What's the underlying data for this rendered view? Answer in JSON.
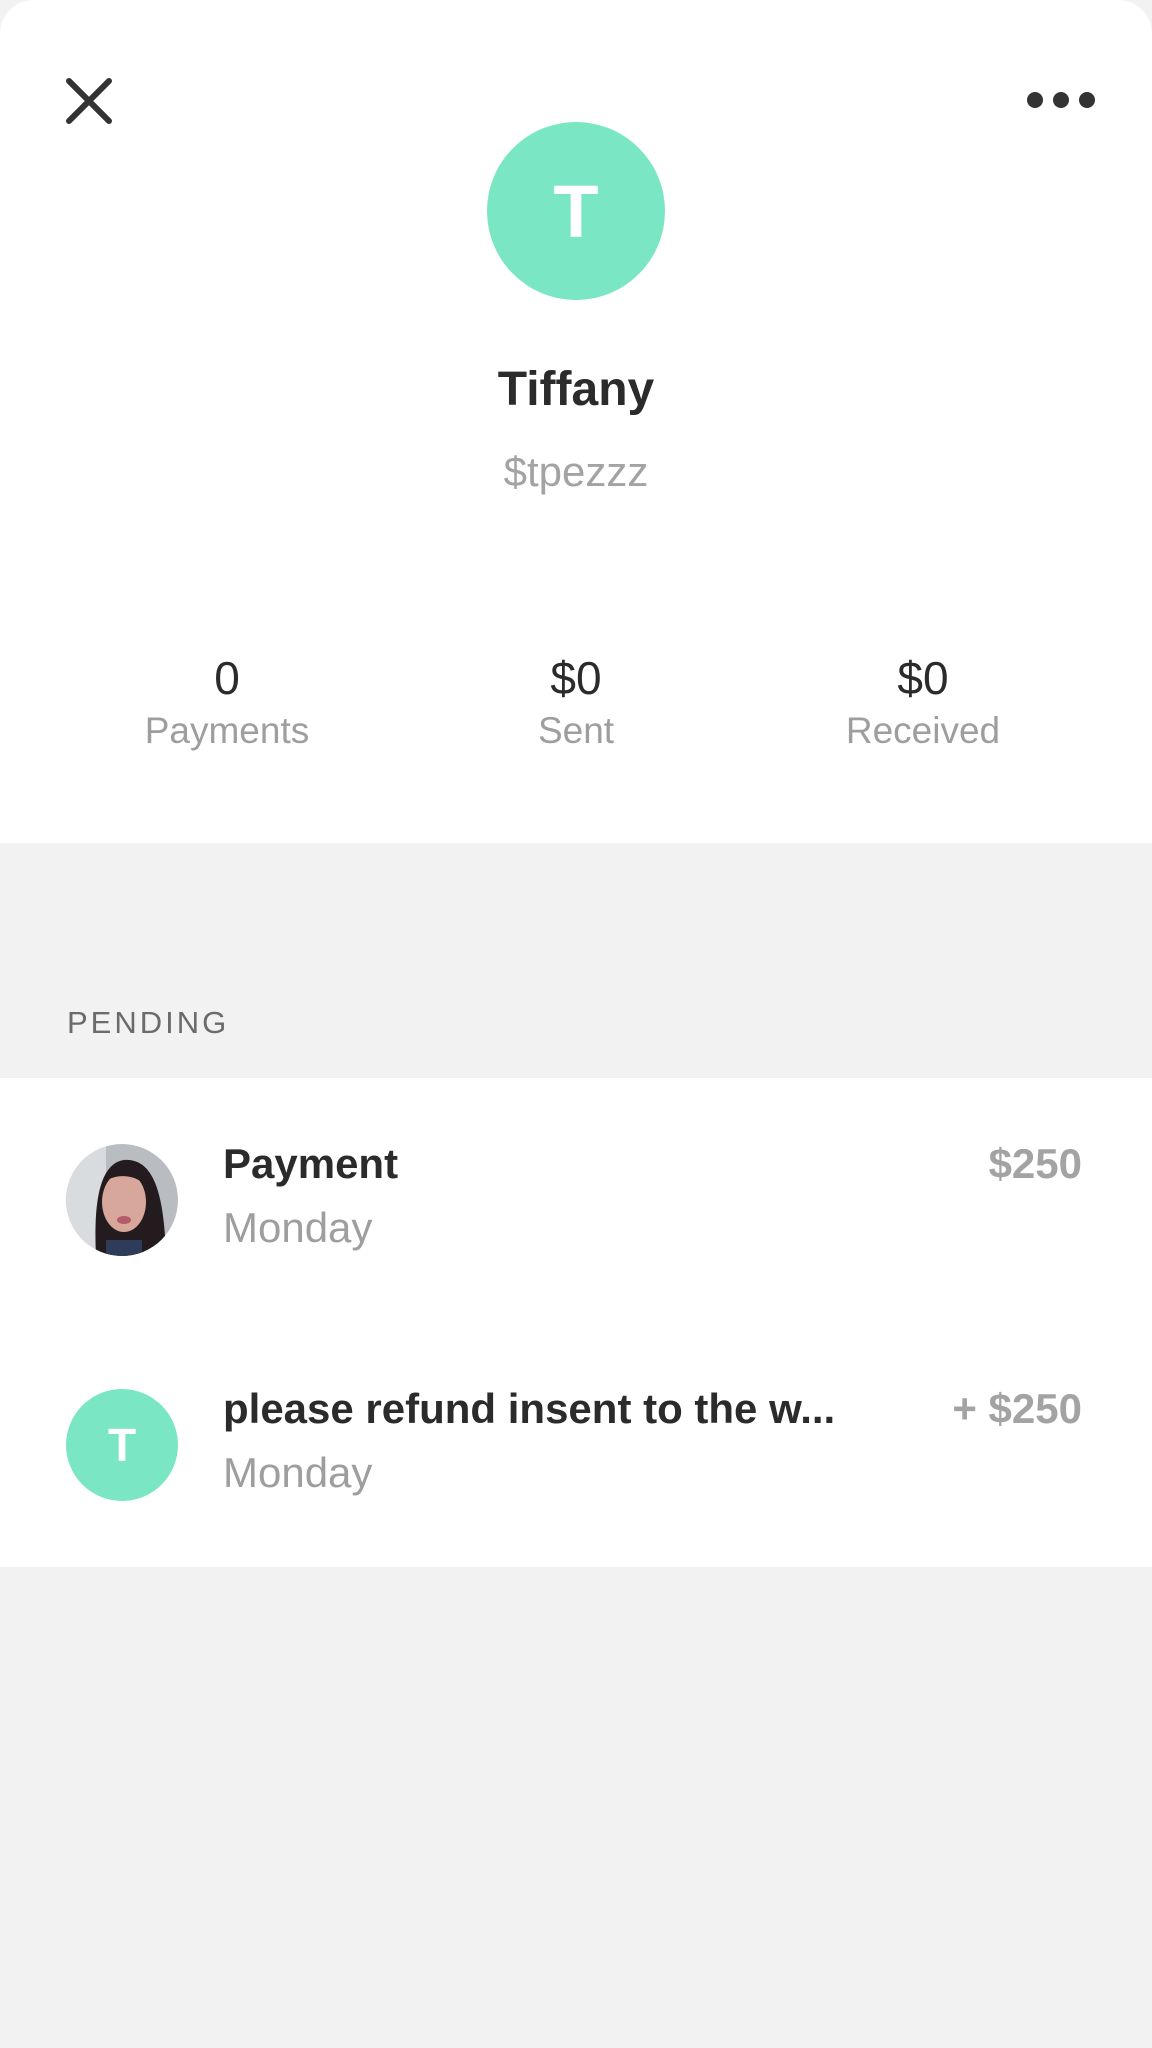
{
  "profile": {
    "avatar_letter": "T",
    "name": "Tiffany",
    "handle": "$tpezzz",
    "avatar_color": "#7be6c4"
  },
  "stats": [
    {
      "value": "0",
      "label": "Payments"
    },
    {
      "value": "$0",
      "label": "Sent"
    },
    {
      "value": "$0",
      "label": "Received"
    }
  ],
  "pending": {
    "header": "PENDING",
    "items": [
      {
        "title": "Payment",
        "subtitle": "Monday",
        "amount": "$250",
        "avatar": "photo-avatar"
      },
      {
        "title": "please refund insent to the w...",
        "subtitle": "Monday",
        "amount": "+ $250",
        "avatar_letter": "T"
      }
    ]
  },
  "icons": {
    "close": "close-icon",
    "more": "more-options-icon"
  }
}
